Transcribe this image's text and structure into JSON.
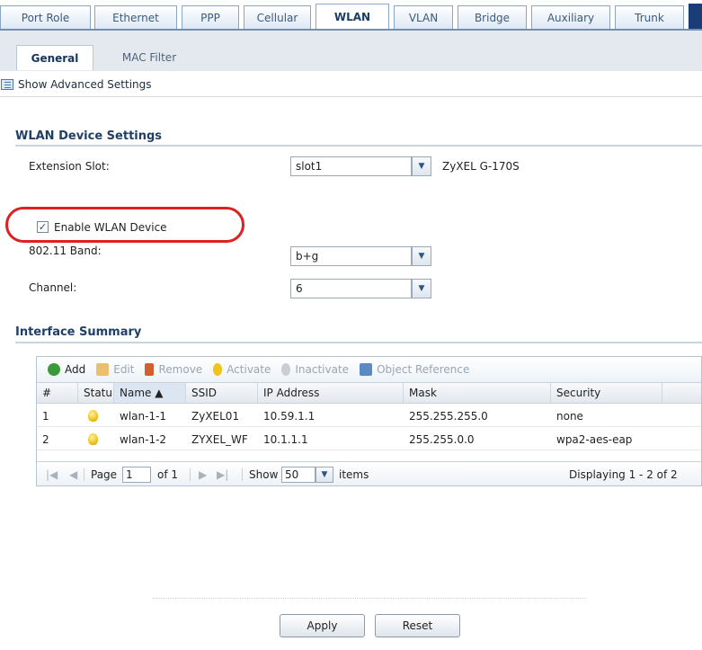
{
  "top_tabs": [
    {
      "label": "Port Role"
    },
    {
      "label": "Ethernet"
    },
    {
      "label": "PPP"
    },
    {
      "label": "Cellular"
    },
    {
      "label": "WLAN"
    },
    {
      "label": "VLAN"
    },
    {
      "label": "Bridge"
    },
    {
      "label": "Auxiliary"
    },
    {
      "label": "Trunk"
    }
  ],
  "active_top_tab": "WLAN",
  "sub_tabs": [
    {
      "label": "General"
    },
    {
      "label": "MAC Filter"
    }
  ],
  "advanced_settings_label": "Show Advanced Settings",
  "wlan_device": {
    "section_title": "WLAN Device Settings",
    "extension_slot_label": "Extension Slot:",
    "extension_slot_value": "slot1",
    "extension_slot_device": "ZyXEL G-170S",
    "enable_label": "Enable WLAN Device",
    "enable_checked": "✓",
    "band_label": "802.11 Band:",
    "band_value": "b+g",
    "channel_label": "Channel:",
    "channel_value": "6"
  },
  "interface_summary": {
    "section_title": "Interface Summary",
    "toolbar": {
      "add": "Add",
      "edit": "Edit",
      "remove": "Remove",
      "activate": "Activate",
      "inactivate": "Inactivate",
      "object_reference": "Object Reference"
    },
    "columns": [
      "#",
      "Statu",
      "Name ▲",
      "SSID",
      "IP Address",
      "Mask",
      "Security"
    ],
    "rows": [
      {
        "num": "1",
        "name": "wlan-1-1",
        "ssid": "ZyXEL01",
        "ip": "10.59.1.1",
        "mask": "255.255.255.0",
        "security": "none"
      },
      {
        "num": "2",
        "name": "wlan-1-2",
        "ssid": "ZYXEL_WF",
        "ip": "10.1.1.1",
        "mask": "255.255.0.0",
        "security": "wpa2-aes-eap"
      }
    ],
    "pager": {
      "page_label": "Page",
      "page_value": "1",
      "of_label": "of 1",
      "show_label": "Show",
      "show_value": "50",
      "items_label": "items",
      "displaying": "Displaying 1 - 2 of 2"
    }
  },
  "buttons": {
    "apply": "Apply",
    "reset": "Reset"
  }
}
